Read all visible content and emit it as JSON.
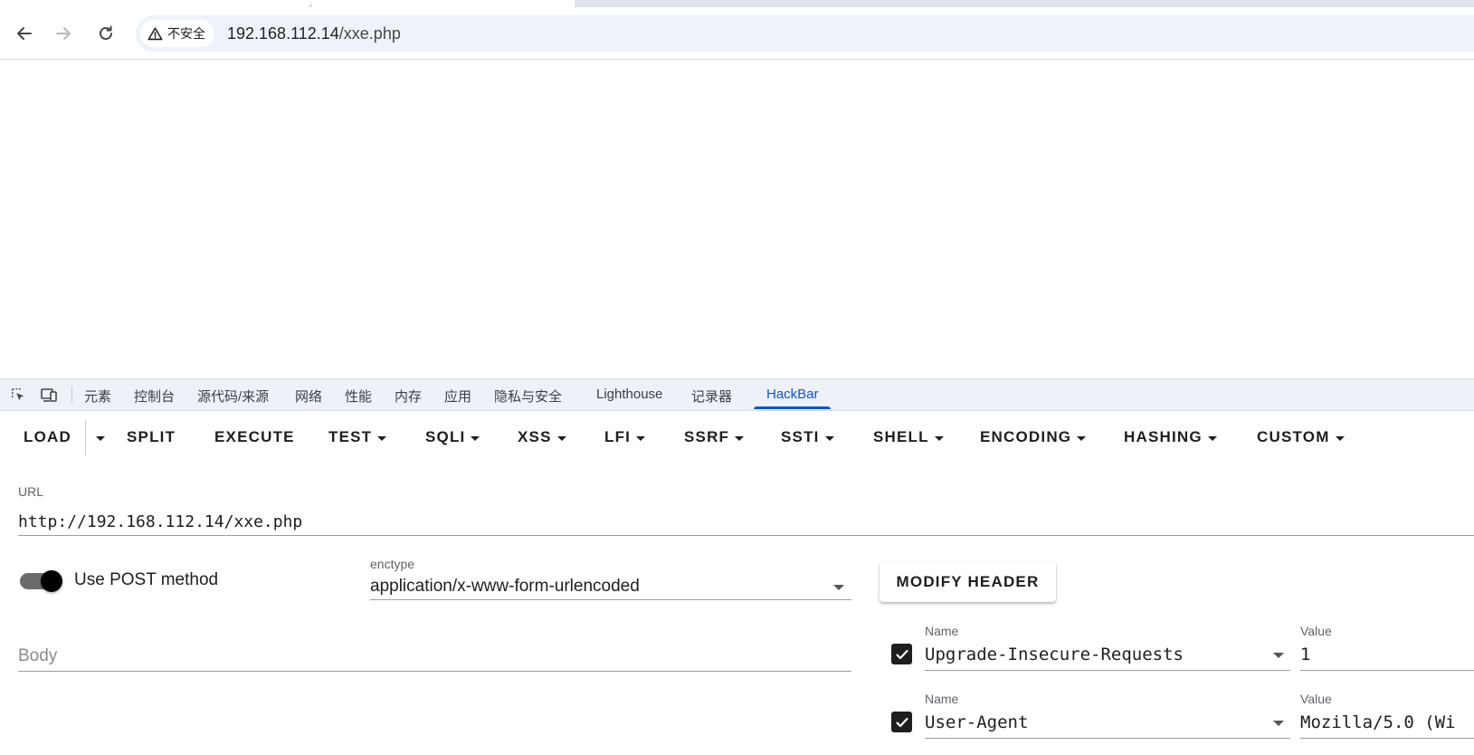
{
  "browser": {
    "security_label": "不安全",
    "url_host": "192.168.112.14",
    "url_path": "/xxe.php"
  },
  "devtools": {
    "tabs": [
      "元素",
      "控制台",
      "源代码/来源",
      "网络",
      "性能",
      "内存",
      "应用",
      "隐私与安全",
      "Lighthouse",
      "记录器",
      "HackBar"
    ],
    "active_tab": "HackBar"
  },
  "hackbar": {
    "menu": [
      {
        "label": "LOAD",
        "dropdown": false
      },
      {
        "label": "SPLIT",
        "dropdown": false
      },
      {
        "label": "EXECUTE",
        "dropdown": false
      },
      {
        "label": "TEST",
        "dropdown": true
      },
      {
        "label": "SQLI",
        "dropdown": true
      },
      {
        "label": "XSS",
        "dropdown": true
      },
      {
        "label": "LFI",
        "dropdown": true
      },
      {
        "label": "SSRF",
        "dropdown": true
      },
      {
        "label": "SSTI",
        "dropdown": true
      },
      {
        "label": "SHELL",
        "dropdown": true
      },
      {
        "label": "ENCODING",
        "dropdown": true
      },
      {
        "label": "HASHING",
        "dropdown": true
      },
      {
        "label": "CUSTOM",
        "dropdown": true
      }
    ],
    "url_label": "URL",
    "url_value": "http://192.168.112.14/xxe.php",
    "post_label": "Use POST method",
    "post_enabled": true,
    "enctype_label": "enctype",
    "enctype_value": "application/x-www-form-urlencoded",
    "modify_header_label": "MODIFY HEADER",
    "body_placeholder": "Body",
    "body_value": "",
    "headers": [
      {
        "checked": true,
        "name_label": "Name",
        "name": "Upgrade-Insecure-Requests",
        "value_label": "Value",
        "value": "1"
      },
      {
        "checked": true,
        "name_label": "Name",
        "name": "User-Agent",
        "value_label": "Value",
        "value": "Mozilla/5.0 (Wi"
      }
    ]
  }
}
